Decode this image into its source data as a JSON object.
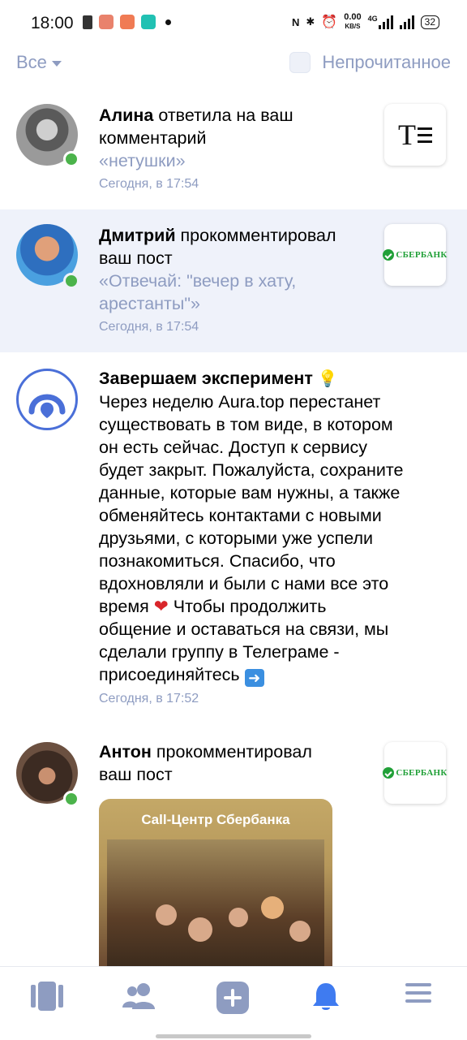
{
  "status_bar": {
    "time": "18:00",
    "net_speed_value": "0.00",
    "net_speed_unit": "KB/S",
    "network": "4G",
    "battery": "32"
  },
  "filter": {
    "all_label": "Все",
    "unread_label": "Непрочитанное",
    "unread_checked": false
  },
  "notifications": [
    {
      "name": "Алина",
      "action": " ответила на ваш",
      "action2": "комментарий",
      "quote": "«нетушки»",
      "time": "Сегодня, в 17:54",
      "online": true
    },
    {
      "name": "Дмитрий",
      "action": " прокомментировал",
      "action2": "ваш пост",
      "quote1": "«Отвечай: \"вечер в хату,",
      "quote2": "арестанты\"»",
      "time": "Сегодня, в 17:54",
      "online": true,
      "thumb_brand": "СБЕРБАНК"
    },
    {
      "title": "Завершаем эксперимент",
      "lines": [
        "Через неделю Aura.top перестанет",
        "существовать в том виде, в котором",
        "он есть сейчас. Доступ к сервису",
        "будет закрыт. Пожалуйста, сохраните",
        "данные, которые вам нужны, а также",
        "обменяйтесь контактами с новыми",
        "друзьями, с которыми уже успели",
        "познакомиться. Спасибо, что",
        "вдохновляли и были с нами все это"
      ],
      "line_heart_before": "время",
      "line_heart_after": " Чтобы продолжить",
      "lines_after": [
        "общение и оставаться на связи, мы",
        "сделали группу в Телеграме -"
      ],
      "last_line": "присоединяйтесь ",
      "time": "Сегодня, в 17:52"
    },
    {
      "name": "Антон",
      "action": " прокомментировал",
      "action2": "ваш пост",
      "online": true,
      "thumb_brand": "СБЕРБАНК",
      "image_title": "Call-Центр Сбербанка"
    }
  ],
  "bottom_nav": [
    "feed-icon",
    "friends-icon",
    "add-icon",
    "notifications-icon",
    "menu-icon"
  ],
  "colors": {
    "accent": "#4a6fd8",
    "muted": "#8e9cc1",
    "nav_icon": "#8e9cc1",
    "active": "#3f7bf0",
    "online": "#4bb34b",
    "highlight_bg": "#eff2fa"
  }
}
